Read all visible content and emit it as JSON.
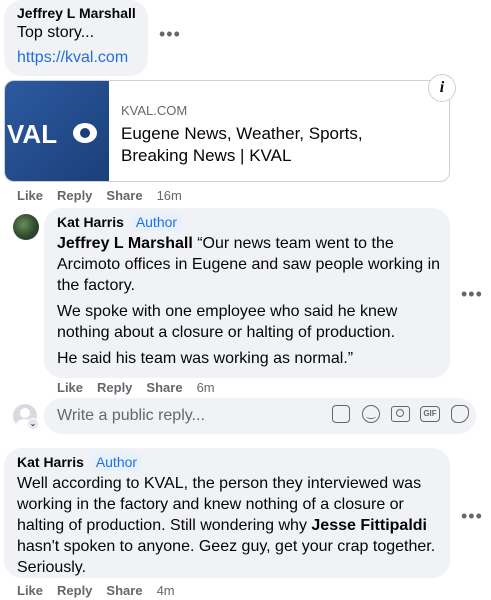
{
  "comment1": {
    "author": "Jeffrey L Marshall",
    "text": "Top story...",
    "link": "https://kval.com",
    "card": {
      "domain": "KVAL.COM",
      "title": "Eugene News, Weather, Sports, Breaking News | KVAL",
      "logo_text": "VAL"
    },
    "actions": {
      "like": "Like",
      "reply": "Reply",
      "share": "Share",
      "time": "16m"
    }
  },
  "reply1": {
    "author": "Kat Harris",
    "badge": "Author",
    "mention": "Jeffrey L Marshall",
    "para1": " “Our news team went to the Arcimoto offices in Eugene and saw people working in the factory.",
    "para2": "We spoke with one employee who said he knew nothing about a closure or halting of production.",
    "para3": "He said his team was working as normal.”",
    "actions": {
      "like": "Like",
      "reply": "Reply",
      "share": "Share",
      "time": "6m"
    }
  },
  "reply_input": {
    "placeholder": "Write a public reply..."
  },
  "comment2": {
    "author": "Kat Harris",
    "badge": "Author",
    "text_before": "Well according to KVAL, the person they interviewed was working in the factory and knew nothing of a closure or halting of production. Still wondering why ",
    "mention": "Jesse Fittipaldi",
    "text_after": " hasn't spoken to anyone. Geez guy, get your crap together. Seriously.",
    "actions": {
      "like": "Like",
      "reply": "Reply",
      "share": "Share",
      "time": "4m"
    }
  },
  "icons": {
    "more": "more-options-icon",
    "info": "info-icon",
    "sticker": "sticker-icon",
    "emoji": "emoji-icon",
    "camera": "camera-icon",
    "gif": "gif-icon",
    "avatar_sticker": "avatar-sticker-icon"
  },
  "colors": {
    "link": "#216fdb",
    "bubble": "#f0f2f5",
    "meta": "#65676b"
  }
}
